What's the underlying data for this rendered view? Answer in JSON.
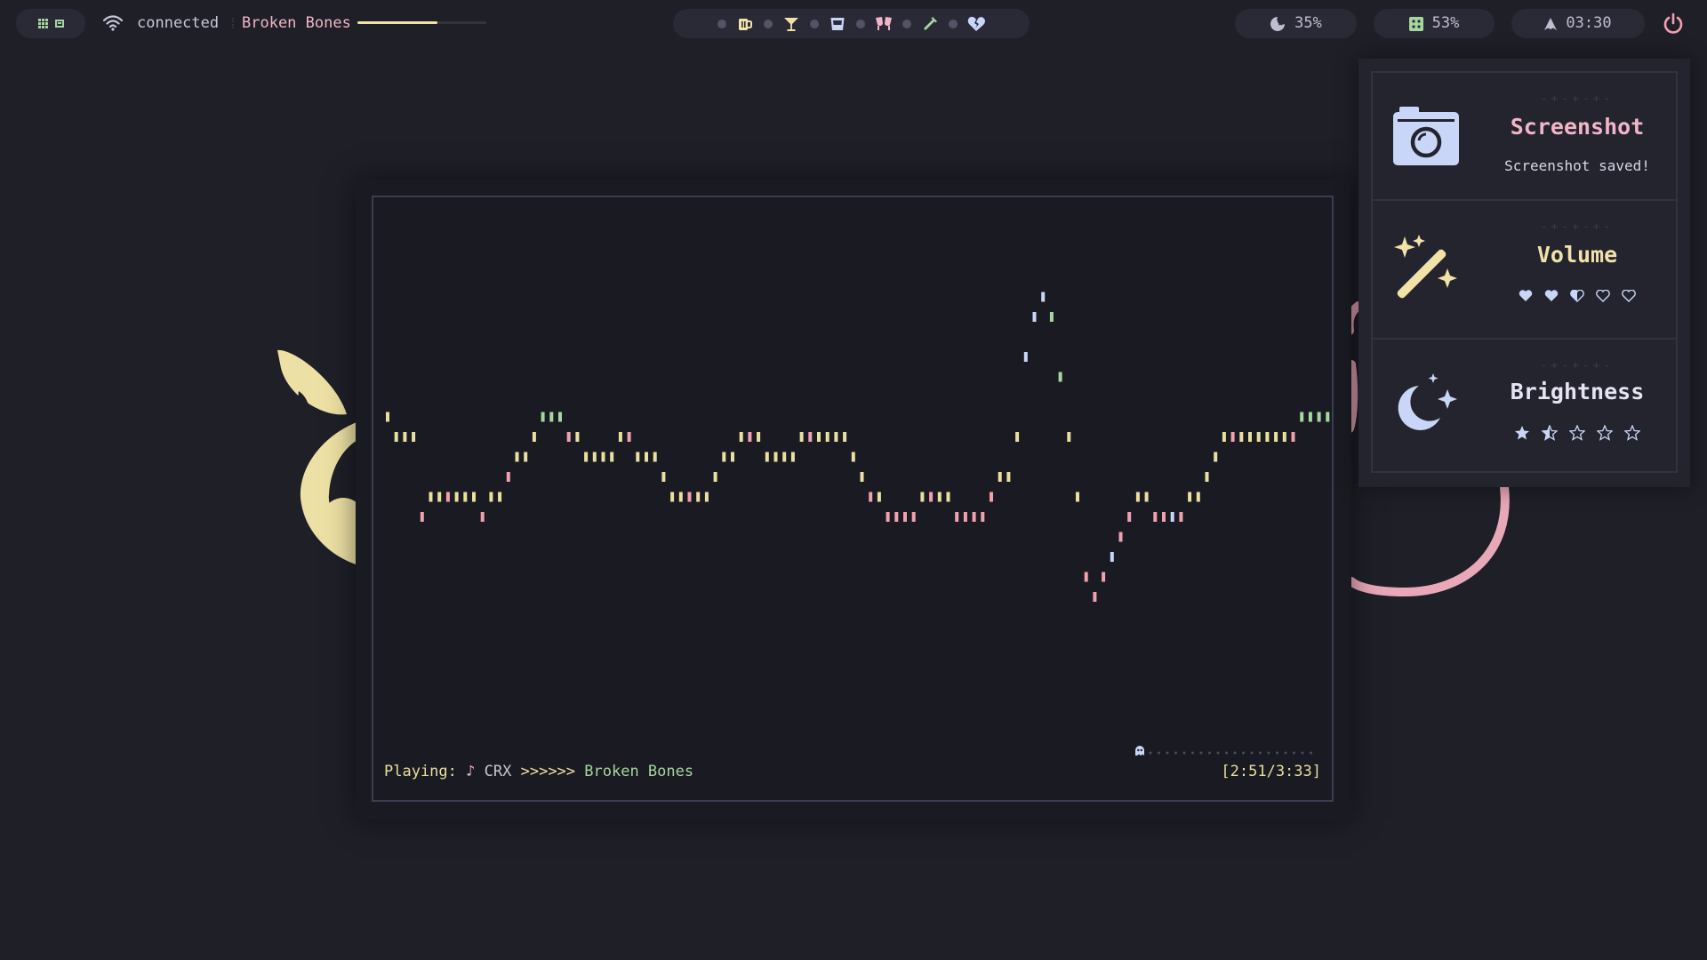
{
  "topbar": {
    "launcher_icons": [
      "grid-icon",
      "square-icon"
    ],
    "network": {
      "icon": "wifi-icon",
      "status": "connected"
    },
    "media": {
      "title": "Broken Bones",
      "progress": 0.62,
      "progress_color": "#f1e2a8"
    },
    "workspaces": [
      {
        "icon": "beer-mug-icon",
        "color": "#f1e2a8"
      },
      {
        "icon": "cocktail-glass-icon",
        "color": "#f1e2a8"
      },
      {
        "icon": "whisky-glass-icon",
        "color": "#c9d6f8"
      },
      {
        "icon": "glasses-cheers-icon",
        "color": "#f1b6c6"
      },
      {
        "icon": "bottle-icon",
        "color": "#a6d6a0"
      },
      {
        "icon": "broken-heart-icon",
        "color": "#c9d6f8"
      }
    ],
    "cpu": {
      "icon": "moon-star-icon",
      "value": "35%"
    },
    "memory": {
      "icon": "memory-chip-icon",
      "value": "53%"
    },
    "clock": {
      "icon": "arch-icon",
      "value": "03:30"
    },
    "power": {
      "icon": "power-icon",
      "color": "#f1a0ae"
    }
  },
  "player": {
    "playing_label": "Playing:",
    "note_icon": "music-note-icon",
    "artist": "CRX",
    "separator": ">>>>>>",
    "song": "Broken Bones",
    "time": "[2:51/3:33]",
    "progress_icon": "ghost-icon",
    "colors": [
      "#c9d6f8",
      "#a6d6a0",
      "#e9df9e",
      "#f1a0ae"
    ]
  },
  "notifications": [
    {
      "icon": "camera-icon",
      "title": "Screenshot",
      "title_color": "#f1b6c6",
      "body": "Screenshot saved!"
    },
    {
      "icon": "magic-wand-icon",
      "title": "Volume",
      "title_color": "#f1e2a8",
      "rating_icon": "heart-icon",
      "level": "2.5/5"
    },
    {
      "icon": "moon-stars-icon",
      "title": "Brightness",
      "title_color": "#e6e4f2",
      "rating_icon": "star-icon",
      "level": "1.5/5"
    }
  ]
}
